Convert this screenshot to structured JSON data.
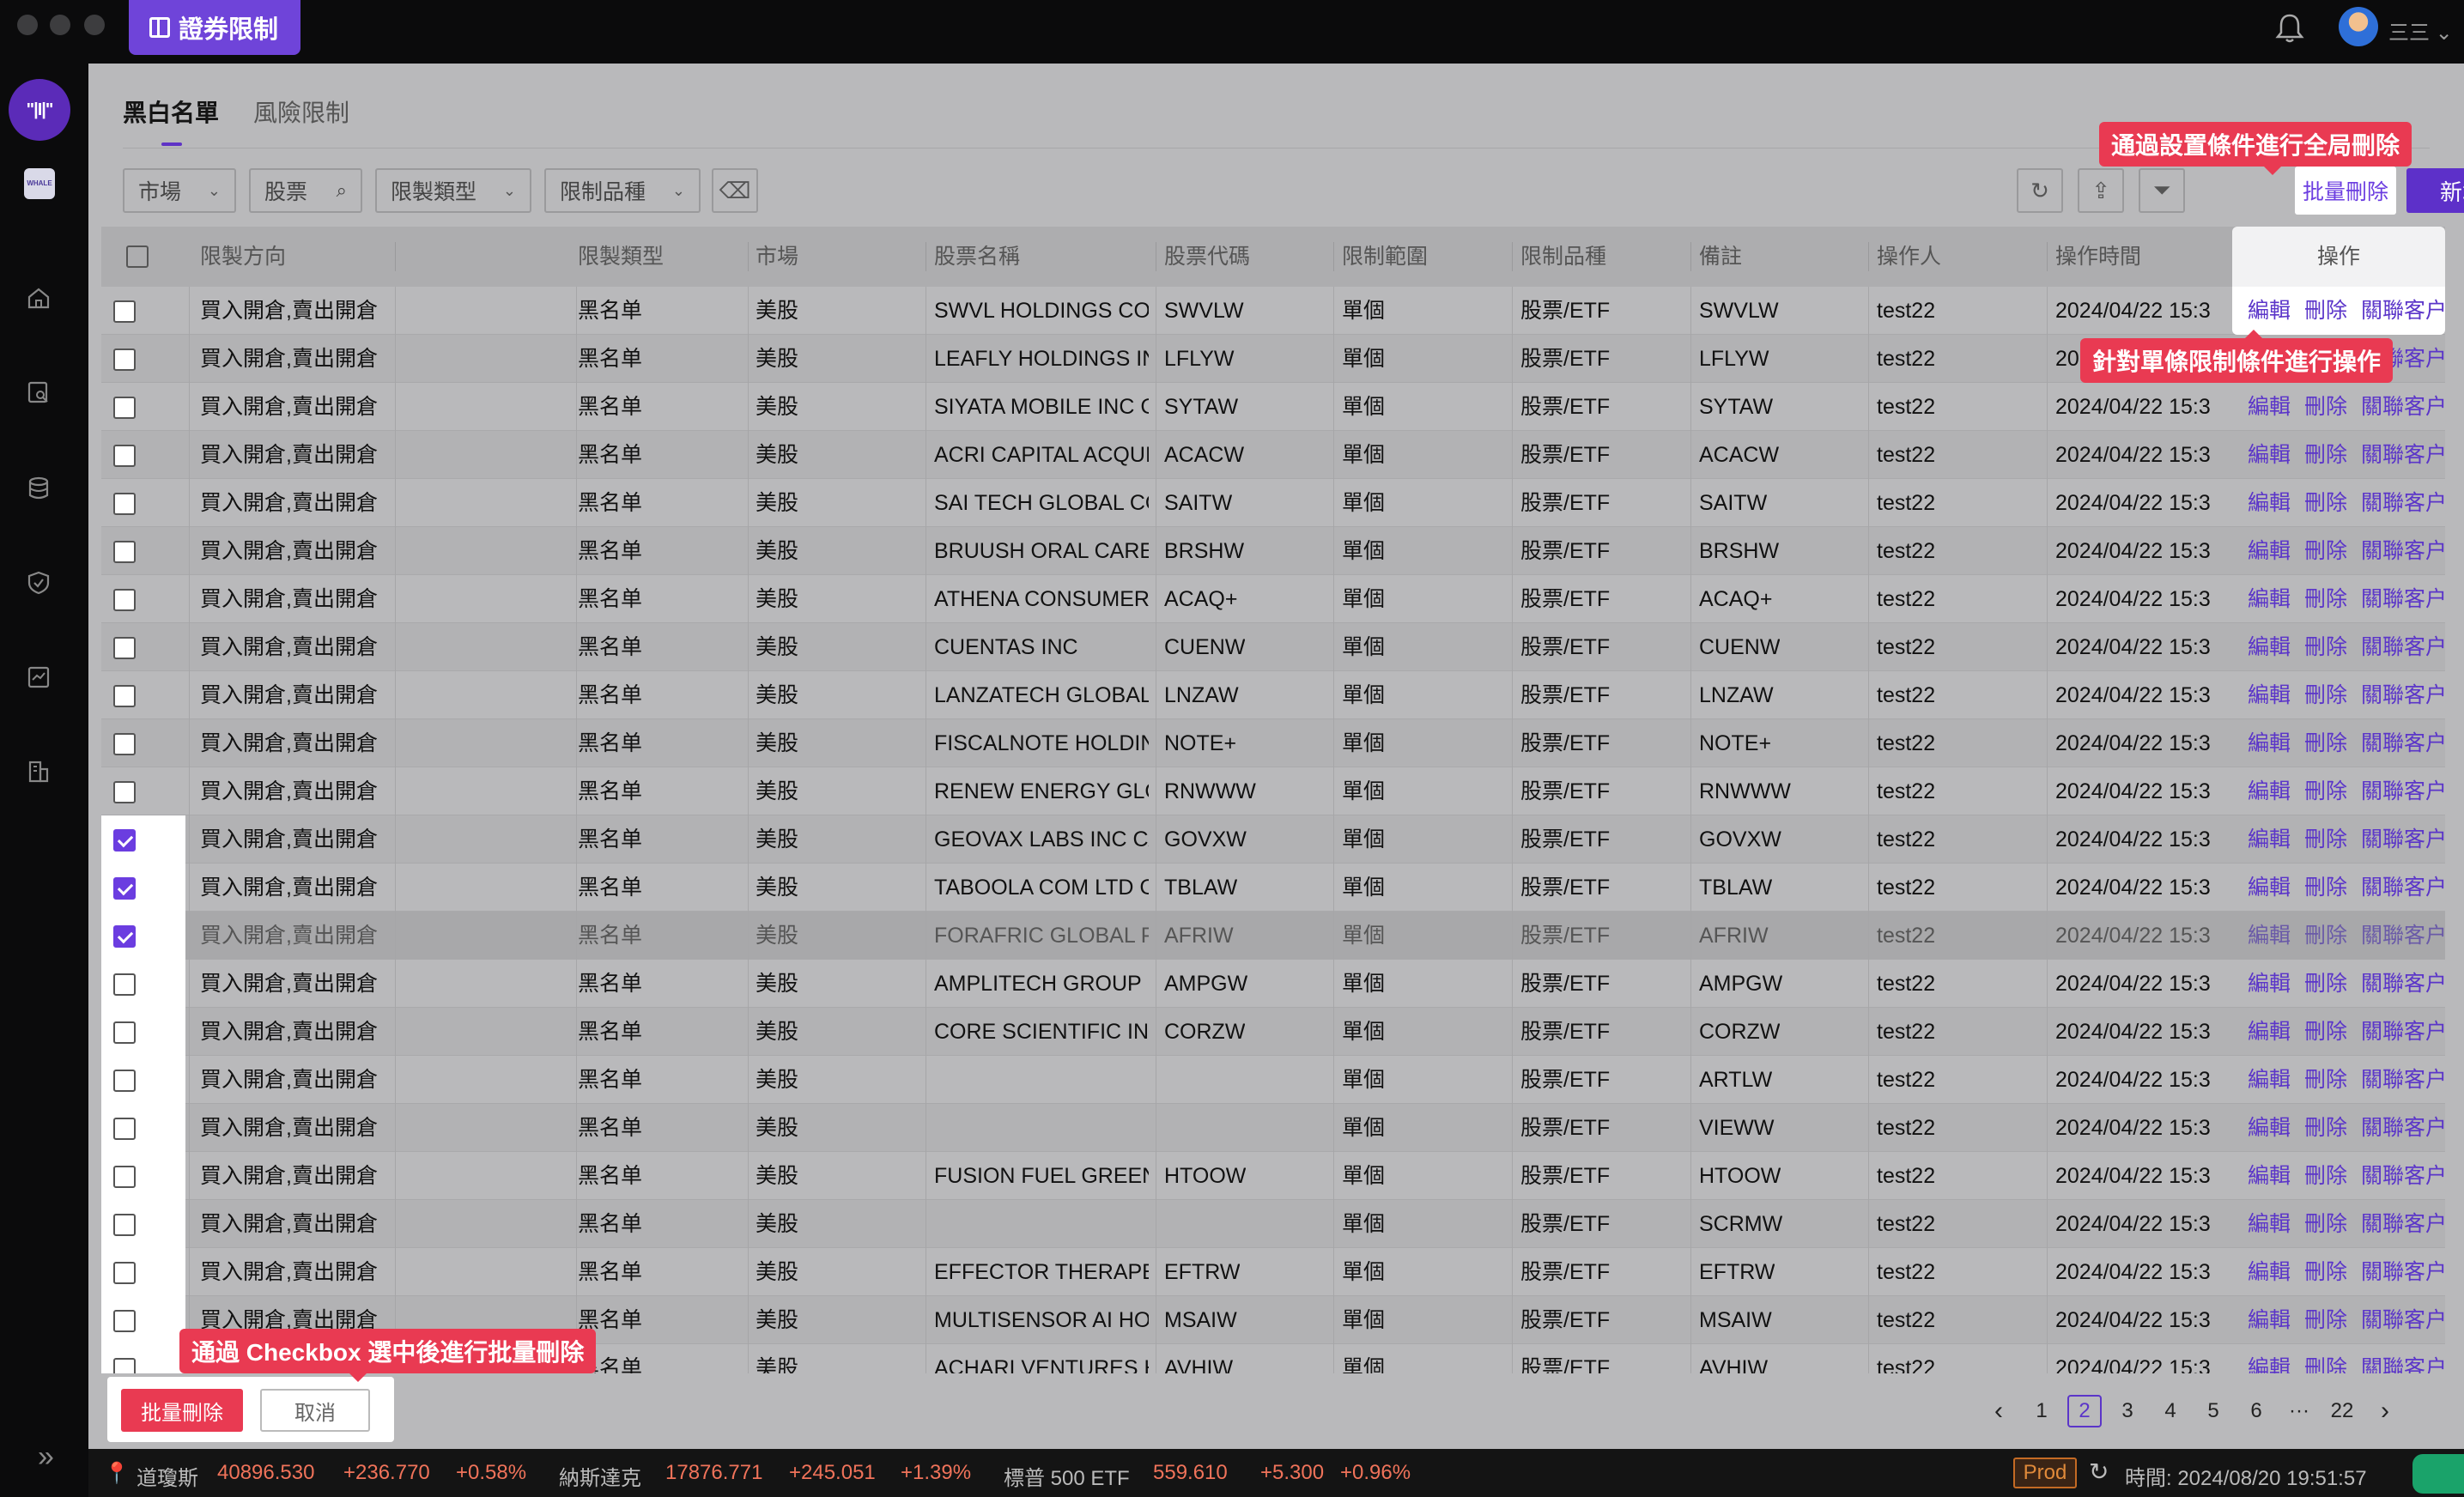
{
  "app": {
    "title": "證券限制",
    "user": "三三"
  },
  "sub_tabs": [
    "黑白名單",
    "風險限制"
  ],
  "filters": {
    "market": "市場",
    "stock": "股票",
    "limit_type": "限製類型",
    "limit_variety": "限制品種"
  },
  "toolbar": {
    "batch_delete": "批量刪除",
    "add": "新增"
  },
  "tips": {
    "global_delete": "通過設置條件進行全局刪除",
    "row_ops": "針對單條限制條件進行操作",
    "checkbox_delete": "通過 Checkbox 選中後進行批量刪除"
  },
  "columns": [
    "限製方向",
    "限製類型",
    "市場",
    "股票名稱",
    "股票代碼",
    "限制範圍",
    "限制品種",
    "備註",
    "操作人",
    "操作時間",
    "操作"
  ],
  "row_defaults": {
    "direction": "買入開倉,賣出開倉",
    "type": "黑名单",
    "market": "美股",
    "scope": "單個",
    "variety": "股票/ETF",
    "operator": "test22",
    "time": "2024/04/22 15:3"
  },
  "row_ops": [
    "編輯",
    "刪除",
    "關聯客户"
  ],
  "rows": [
    {
      "name": "SWVL HOLDINGS COF",
      "code": "SWVLW",
      "note": "SWVLW",
      "checked": false
    },
    {
      "name": "LEAFLY HOLDINGS IN",
      "code": "LFLYW",
      "note": "LFLYW",
      "checked": false
    },
    {
      "name": "SIYATA MOBILE INC C",
      "code": "SYTAW",
      "note": "SYTAW",
      "checked": false
    },
    {
      "name": "ACRI CAPITAL ACQUIS",
      "code": "ACACW",
      "note": "ACACW",
      "checked": false
    },
    {
      "name": "SAI TECH GLOBAL CO",
      "code": "SAITW",
      "note": "SAITW",
      "checked": false
    },
    {
      "name": "BRUUSH ORAL CARE I",
      "code": "BRSHW",
      "note": "BRSHW",
      "checked": false
    },
    {
      "name": "ATHENA CONSUMER /",
      "code": "ACAQ+",
      "note": "ACAQ+",
      "checked": false
    },
    {
      "name": "CUENTAS INC",
      "code": "CUENW",
      "note": "CUENW",
      "checked": false
    },
    {
      "name": "LANZATECH GLOBAL",
      "code": "LNZAW",
      "note": "LNZAW",
      "checked": false
    },
    {
      "name": "FISCALNOTE HOLDIN(",
      "code": "NOTE+",
      "note": "NOTE+",
      "checked": false
    },
    {
      "name": "RENEW ENERGY GLO",
      "code": "RNWWW",
      "note": "RNWWW",
      "checked": false
    },
    {
      "name": "GEOVAX LABS INC C/\\",
      "code": "GOVXW",
      "note": "GOVXW",
      "checked": true
    },
    {
      "name": "TABOOLA COM LTD C",
      "code": "TBLAW",
      "note": "TBLAW",
      "checked": true
    },
    {
      "name": "FORAFRIC GLOBAL PL",
      "code": "AFRIW",
      "note": "AFRIW",
      "checked": true
    },
    {
      "name": "AMPLITECH GROUP IN",
      "code": "AMPGW",
      "note": "AMPGW",
      "checked": false
    },
    {
      "name": "CORE SCIENTIFIC INC",
      "code": "CORZW",
      "note": "CORZW",
      "checked": false
    },
    {
      "name": "",
      "code": "",
      "note": "ARTLW",
      "checked": false
    },
    {
      "name": "",
      "code": "",
      "note": "VIEWW",
      "checked": false
    },
    {
      "name": "FUSION FUEL GREEN",
      "code": "HTOOW",
      "note": "HTOOW",
      "checked": false
    },
    {
      "name": "",
      "code": "",
      "note": "SCRMW",
      "checked": false
    },
    {
      "name": "EFFECTOR THERAPEL",
      "code": "EFTRW",
      "note": "EFTRW",
      "checked": false
    },
    {
      "name": "MULTISENSOR AI HOL",
      "code": "MSAIW",
      "note": "MSAIW",
      "checked": false
    },
    {
      "name": "ACHARI VENTURES HI",
      "code": "AVHIW",
      "note": "AVHIW",
      "checked": false
    }
  ],
  "bulk": {
    "delete": "批量刪除",
    "cancel": "取消"
  },
  "pagination": {
    "pages": [
      "1",
      "2",
      "3",
      "4",
      "5",
      "6",
      "···",
      "22"
    ],
    "current": "2"
  },
  "ticker": {
    "dow": {
      "label": "道瓊斯",
      "value": "40896.530",
      "change": "+236.770",
      "pct": "+0.58%"
    },
    "nasdaq": {
      "label": "納斯達克",
      "value": "17876.771",
      "change": "+245.051",
      "pct": "+1.39%"
    },
    "sp500": {
      "label": "標普 500 ETF",
      "value": "559.610",
      "change": "+5.300",
      "pct": "+0.96%"
    },
    "env": "Prod",
    "time": "時間: 2024/08/20 19:51:57"
  },
  "colors": {
    "accent": "#5d30c9",
    "tip": "#e93a52",
    "up": "#f0735a"
  }
}
